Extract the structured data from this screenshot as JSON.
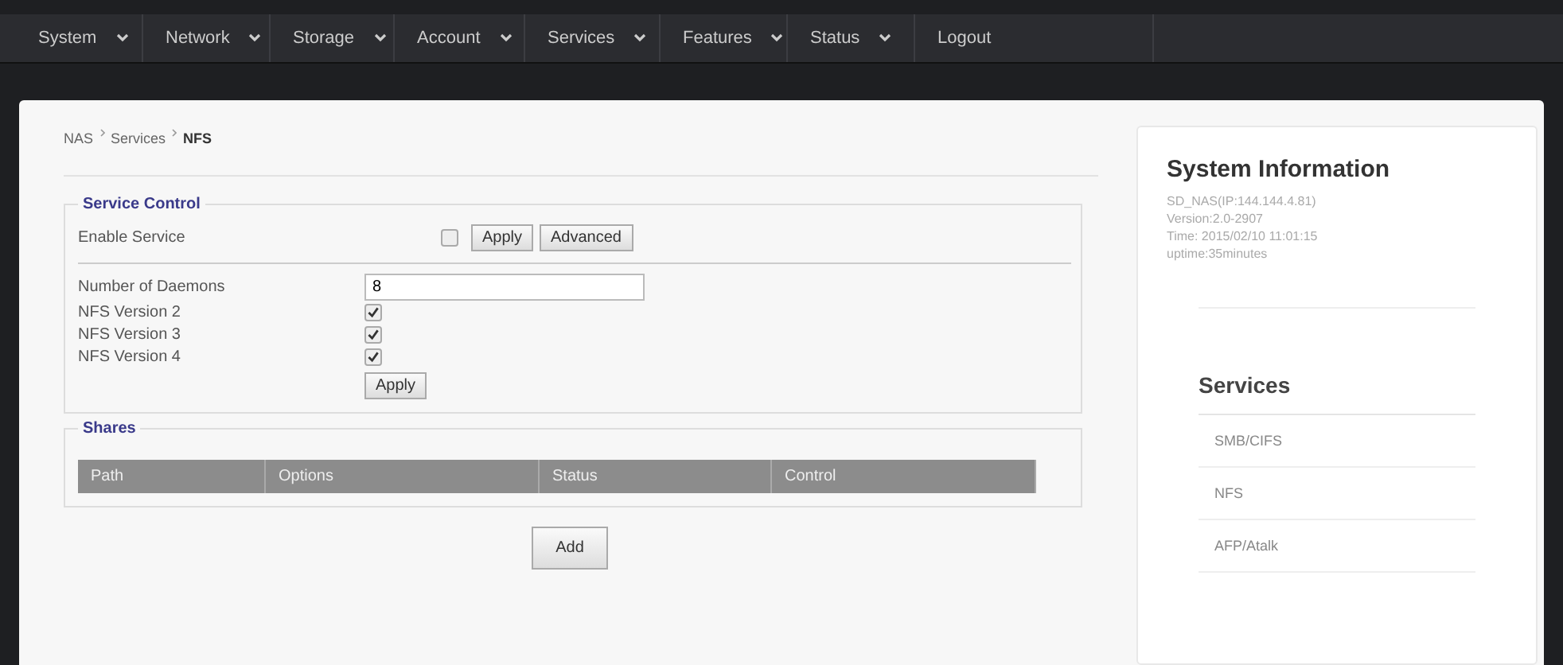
{
  "nav": [
    {
      "label": "System",
      "dropdown": true
    },
    {
      "label": "Network",
      "dropdown": true
    },
    {
      "label": "Storage",
      "dropdown": true
    },
    {
      "label": "Account",
      "dropdown": true
    },
    {
      "label": "Services",
      "dropdown": true
    },
    {
      "label": "Features",
      "dropdown": true
    },
    {
      "label": "Status",
      "dropdown": true
    },
    {
      "label": "Logout",
      "dropdown": false
    }
  ],
  "breadcrumb": [
    "NAS",
    "Services",
    "NFS"
  ],
  "service_control": {
    "legend": "Service Control",
    "enable_label": "Enable Service",
    "enabled": false,
    "apply": "Apply",
    "advanced": "Advanced",
    "daemons_label": "Number of Daemons",
    "daemons_value": "8",
    "versions": [
      {
        "label": "NFS Version 2",
        "checked": true
      },
      {
        "label": "NFS Version 3",
        "checked": true
      },
      {
        "label": "NFS Version 4",
        "checked": true
      }
    ],
    "apply2": "Apply"
  },
  "shares": {
    "legend": "Shares",
    "columns": [
      "Path",
      "Options",
      "Status",
      "Control"
    ],
    "add": "Add"
  },
  "system_info": {
    "title": "System Information",
    "lines": [
      "SD_NAS(IP:144.144.4.81)",
      "Version:2.0-2907",
      "Time: 2015/02/10 11:01:15",
      "uptime:35minutes"
    ]
  },
  "services": {
    "title": "Services",
    "items": [
      "SMB/CIFS",
      "NFS",
      "AFP/Atalk"
    ]
  }
}
